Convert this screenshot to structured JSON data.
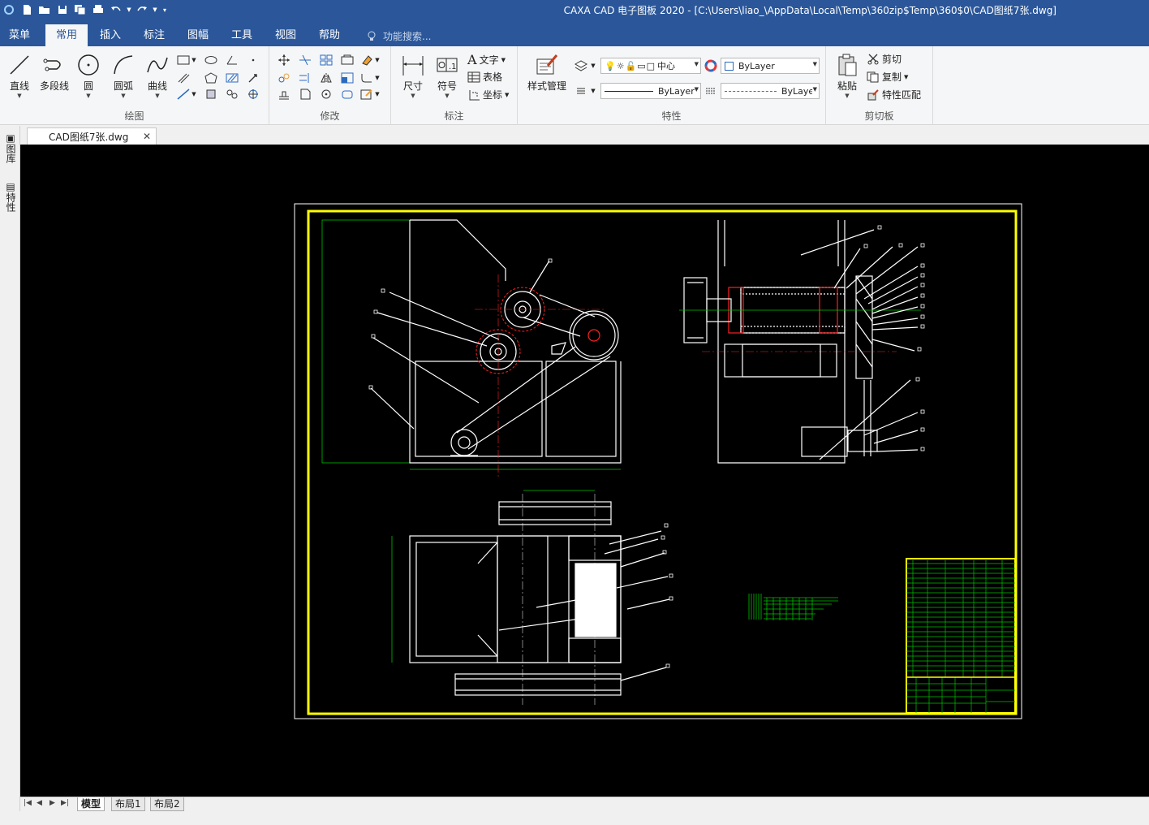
{
  "window": {
    "title": "CAXA CAD 电子图板 2020 - [C:\\Users\\liao_\\AppData\\Local\\Temp\\360zip$Temp\\360$0\\CAD图纸7张.dwg]"
  },
  "menu": {
    "tabs": [
      "菜单",
      "常用",
      "插入",
      "标注",
      "图幅",
      "工具",
      "视图",
      "帮助"
    ],
    "active": "常用",
    "search_placeholder": "功能搜索..."
  },
  "ribbon": {
    "draw": {
      "label": "绘图",
      "line": "直线",
      "polyline": "多段线",
      "circle": "圆",
      "arc": "圆弧",
      "curve": "曲线"
    },
    "modify": {
      "label": "修改"
    },
    "annotate": {
      "label": "标注",
      "dimension": "尺寸",
      "symbol": "符号",
      "text": "文字",
      "table": "表格",
      "coordinate": "坐标"
    },
    "properties": {
      "label": "特性",
      "style_manager": "样式管理",
      "layer_value": "中心",
      "color_value": "ByLayer",
      "linewidth_value": "ByLayer",
      "linetype_value": "ByLayer"
    },
    "clipboard": {
      "label": "剪切板",
      "paste": "粘贴",
      "cut": "剪切",
      "copy": "复制",
      "match_props": "特性匹配"
    }
  },
  "doc_tab": {
    "name": "CAD图纸7张.dwg"
  },
  "side_panel": {
    "library": "图库",
    "properties": "特性"
  },
  "layout_tabs": [
    "模型",
    "布局1",
    "布局2"
  ],
  "active_layout": "模型",
  "colors": {
    "titlebar": "#2b579a",
    "canvas": "#000000",
    "frame": "#ffff00",
    "drawing": "#ffffff",
    "dimension": "#00c000",
    "centerline": "#ff2020"
  }
}
